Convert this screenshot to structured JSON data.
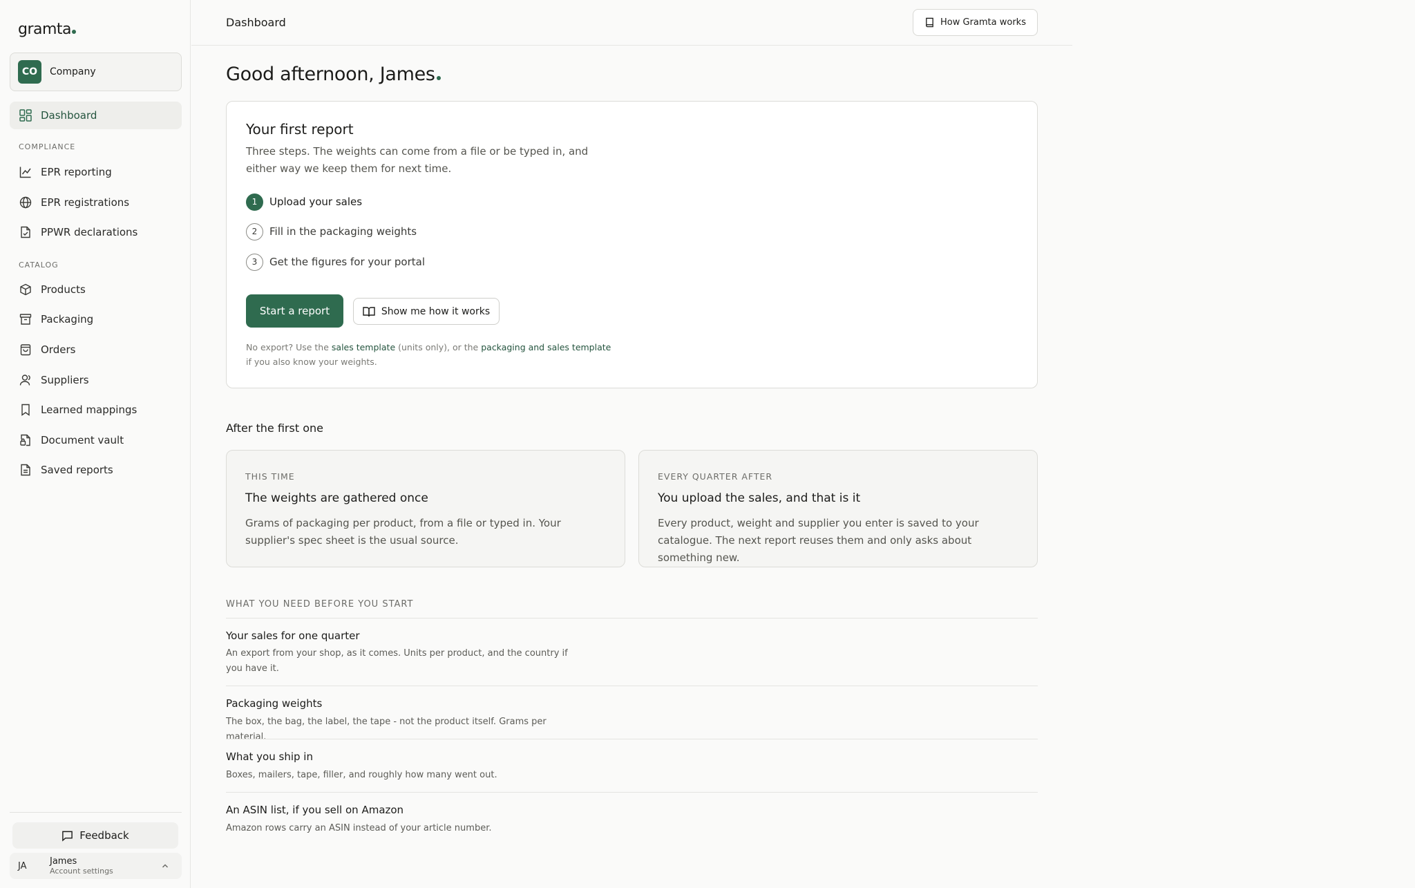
{
  "app": {
    "logo": "gramta",
    "brand_color": "#2f6b4f"
  },
  "sidebar": {
    "org": {
      "initials": "CO",
      "name": "Company"
    },
    "dashboard_label": "Dashboard",
    "compliance_heading": "COMPLIANCE",
    "compliance_items": [
      {
        "label": "EPR reporting",
        "icon": "chart-line-icon"
      },
      {
        "label": "EPR registrations",
        "icon": "globe-icon"
      },
      {
        "label": "PPWR declarations",
        "icon": "file-check-icon"
      }
    ],
    "catalog_heading": "CATALOG",
    "catalog_items": [
      {
        "label": "Products",
        "icon": "box-icon"
      },
      {
        "label": "Packaging",
        "icon": "archive-icon"
      },
      {
        "label": "Orders",
        "icon": "shopping-bag-icon"
      },
      {
        "label": "Suppliers",
        "icon": "user-icon"
      },
      {
        "label": "Learned mappings",
        "icon": "bookmark-icon"
      },
      {
        "label": "Document vault",
        "icon": "file-lock-icon"
      },
      {
        "label": "Saved reports",
        "icon": "file-text-icon"
      }
    ],
    "feedback_label": "Feedback",
    "user": {
      "initials": "JA",
      "name": "James",
      "sub": "Account settings"
    }
  },
  "topbar": {
    "title": "Dashboard",
    "how_label": "How Gramta works"
  },
  "main": {
    "greeting": "Good afternoon, James",
    "first_report": {
      "title": "Your first report",
      "description": "Three steps. The weights can come from a file or be typed in, and either way we keep them for next time.",
      "steps": [
        {
          "num": "1",
          "label": "Upload your sales"
        },
        {
          "num": "2",
          "label": "Fill in the packaging weights"
        },
        {
          "num": "3",
          "label": "Get the figures for your portal"
        }
      ],
      "active_step": 1,
      "start_label": "Start a report",
      "show_label": "Show me how it works",
      "note": {
        "prefix": "No export? Use the ",
        "link1": "sales template",
        "middle": " (units only), or the ",
        "link2": "packaging and sales template",
        "suffix": " if you also know your weights."
      }
    },
    "after_heading": "After the first one",
    "after_cards": [
      {
        "eyebrow": "THIS TIME",
        "title": "The weights are gathered once",
        "desc": "Grams of packaging per product, from a file or typed in. Your supplier's spec sheet is the usual source."
      },
      {
        "eyebrow": "EVERY QUARTER AFTER",
        "title": "You upload the sales, and that is it",
        "desc": "Every product, weight and supplier you enter is saved to your catalogue. The next report reuses them and only asks about something new."
      }
    ],
    "need_heading": "WHAT YOU NEED BEFORE YOU START",
    "needs": [
      {
        "title": "Your sales for one quarter",
        "desc": "An export from your shop, as it comes. Units per product, and the country if you have it."
      },
      {
        "title": "Packaging weights",
        "desc": "The box, the bag, the label, the tape - not the product itself. Grams per material."
      },
      {
        "title": "What you ship in",
        "desc": "Boxes, mailers, tape, filler, and roughly how many went out."
      },
      {
        "title": "An ASIN list, if you sell on Amazon",
        "desc": "Amazon rows carry an ASIN instead of your article number."
      }
    ]
  }
}
